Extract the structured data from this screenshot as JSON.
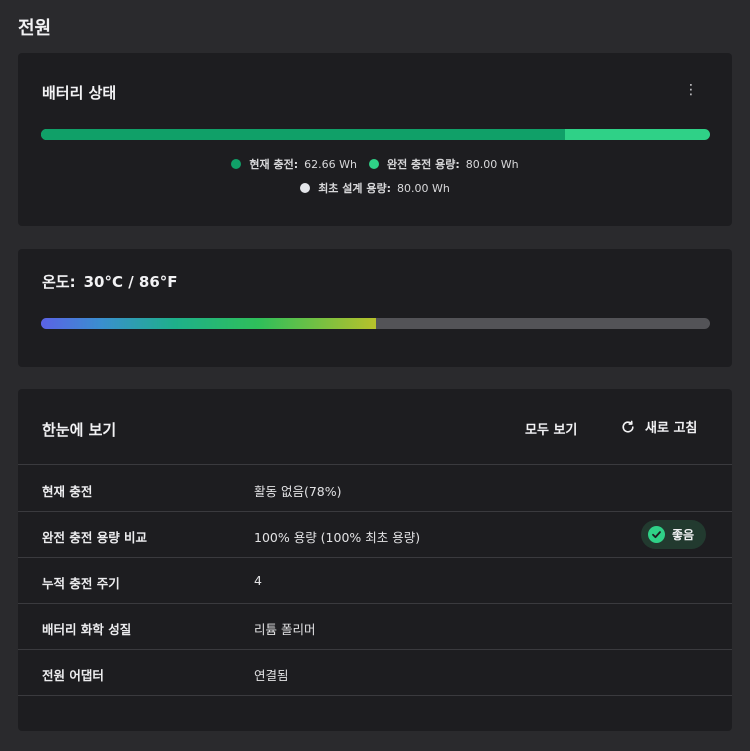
{
  "page": {
    "title": "전원"
  },
  "battery": {
    "title": "배터리 상태",
    "menu_icon": "kebab-menu-icon",
    "current_charge_wh": 62.66,
    "full_capacity_wh": 80.0,
    "design_capacity_wh": 80.0,
    "legend": [
      {
        "label": "현재 충전:",
        "value": "62.66 Wh",
        "color": "#10a068"
      },
      {
        "label": "완전 충전 용량:",
        "value": "80.00 Wh",
        "color": "#2fd187"
      },
      {
        "label": "최초 설계 용량:",
        "value": "80.00 Wh",
        "color": "#e4e6ea"
      }
    ]
  },
  "temperature": {
    "label": "온도:",
    "value": "30°C / 86°F",
    "level_fraction": 0.5
  },
  "glance": {
    "title": "한눈에 보기",
    "view_all_label": "모두 보기",
    "refresh_label": "새로 고침",
    "refresh_icon": "refresh-icon",
    "rows": [
      {
        "label": "현재 충전",
        "value": "활동 없음(78%)"
      },
      {
        "label": "완전 충전 용량 비교",
        "value": "100% 용량 (100% 최초 용량)",
        "badge": "좋음"
      },
      {
        "label": "누적 충전 주기",
        "value": "4"
      },
      {
        "label": "배터리 화학 성질",
        "value": "리튬 폴리머"
      },
      {
        "label": "전원 어댑터",
        "value": "연결됨"
      }
    ]
  },
  "colors": {
    "background": "#2a2a2d",
    "card": "#1d1d20",
    "accent_green": "#2fd187",
    "dark_green": "#10a068"
  }
}
